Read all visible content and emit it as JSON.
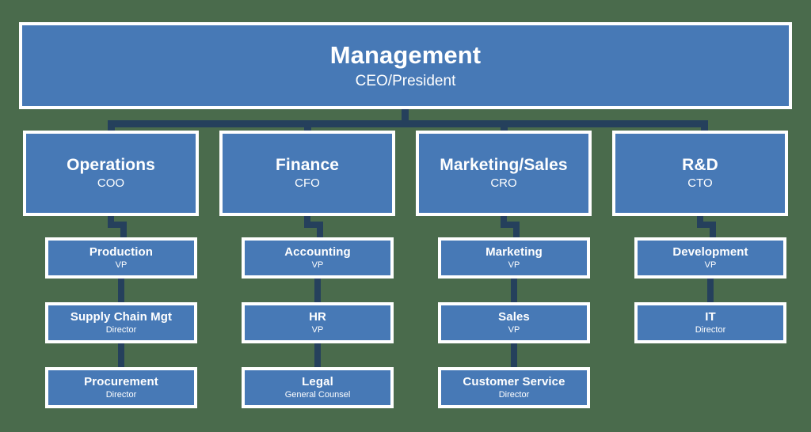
{
  "chart_data": {
    "type": "diagram",
    "diagram_type": "organizational-chart",
    "title": "Management",
    "colors": {
      "background": "#4a6b4c",
      "node_fill": "#4779b6",
      "node_border": "#ffffff",
      "node_text": "#ffffff",
      "connector": "#25405c"
    },
    "levels": 4,
    "root": {
      "title": "Management",
      "subtitle": "CEO/President"
    },
    "divisions": [
      {
        "title": "Operations",
        "subtitle": "COO",
        "children": [
          {
            "title": "Production",
            "subtitle": "VP"
          },
          {
            "title": "Supply Chain Mgt",
            "subtitle": "Director"
          },
          {
            "title": "Procurement",
            "subtitle": "Director"
          }
        ]
      },
      {
        "title": "Finance",
        "subtitle": "CFO",
        "children": [
          {
            "title": "Accounting",
            "subtitle": "VP"
          },
          {
            "title": "HR",
            "subtitle": "VP"
          },
          {
            "title": "Legal",
            "subtitle": "General Counsel"
          }
        ]
      },
      {
        "title": "Marketing/Sales",
        "subtitle": "CRO",
        "children": [
          {
            "title": "Marketing",
            "subtitle": "VP"
          },
          {
            "title": "Sales",
            "subtitle": "VP"
          },
          {
            "title": "Customer Service",
            "subtitle": "Director"
          }
        ]
      },
      {
        "title": "R&D",
        "subtitle": "CTO",
        "children": [
          {
            "title": "Development",
            "subtitle": "VP"
          },
          {
            "title": "IT",
            "subtitle": "Director"
          }
        ]
      }
    ]
  }
}
